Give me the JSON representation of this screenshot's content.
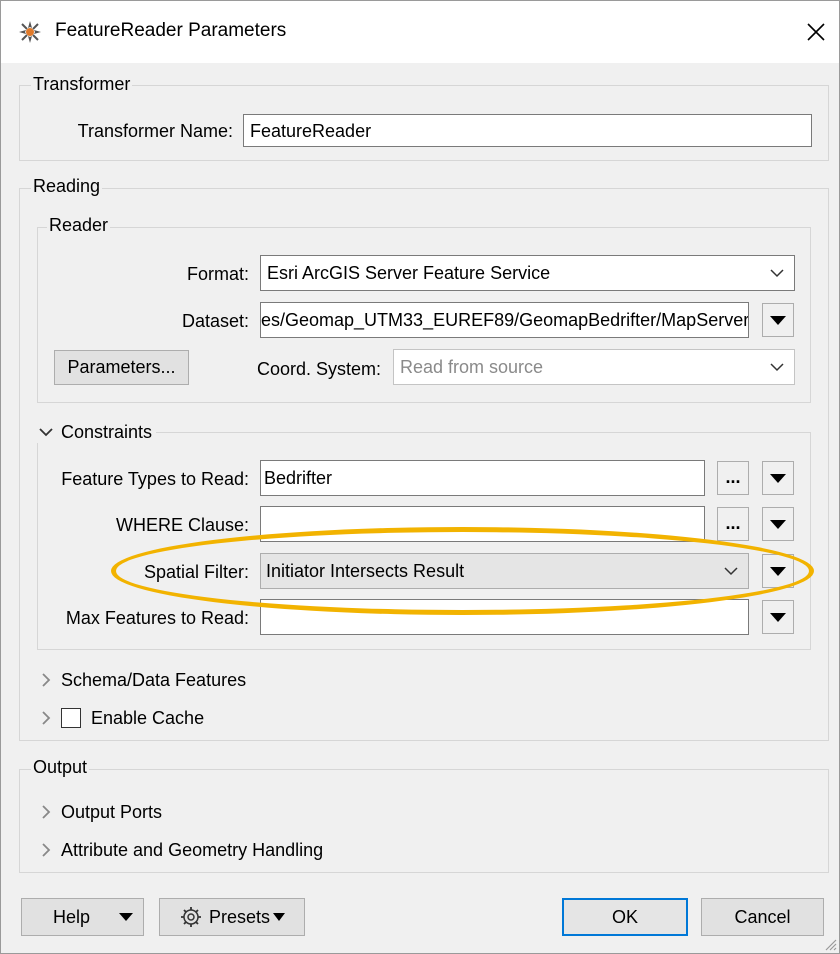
{
  "window": {
    "title": "FeatureReader Parameters"
  },
  "transformer": {
    "group_label": "Transformer",
    "name_label": "Transformer Name:",
    "name_value": "FeatureReader"
  },
  "reading": {
    "group_label": "Reading",
    "reader": {
      "group_label": "Reader",
      "format_label": "Format:",
      "format_value": "Esri ArcGIS Server Feature Service",
      "dataset_label": "Dataset:",
      "dataset_value": "es/Geomap_UTM33_EUREF89/GeomapBedrifter/MapServer",
      "parameters_button": "Parameters...",
      "coord_label": "Coord. System:",
      "coord_placeholder": "Read from source"
    },
    "constraints": {
      "label": "Constraints",
      "feature_types_label": "Feature Types to Read:",
      "feature_types_value": "Bedrifter",
      "where_label": "WHERE Clause:",
      "where_value": "",
      "spatial_filter_label": "Spatial Filter:",
      "spatial_filter_value": "Initiator Intersects Result",
      "max_features_label": "Max Features to Read:",
      "max_features_value": ""
    },
    "schema_section": "Schema/Data Features",
    "cache_section": "Enable Cache"
  },
  "output": {
    "group_label": "Output",
    "ports_section": "Output Ports",
    "attr_section": "Attribute and Geometry Handling"
  },
  "footer": {
    "help": "Help",
    "presets": "Presets",
    "ok": "OK",
    "cancel": "Cancel"
  },
  "colors": {
    "highlight": "#f2b300",
    "accent": "#0078d7"
  }
}
